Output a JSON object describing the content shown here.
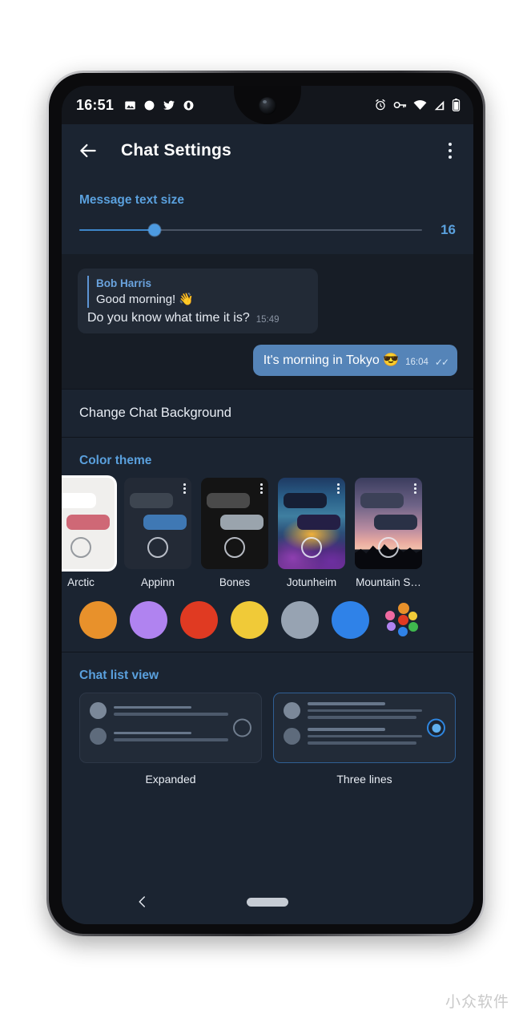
{
  "statusbar": {
    "time": "16:51",
    "left_icons": [
      "gallery-icon",
      "circle-icon",
      "twitter-icon",
      "opera-icon"
    ],
    "right_icons": [
      "alarm-icon",
      "vpn-key-icon",
      "wifi-icon",
      "signal-icon",
      "battery-icon"
    ]
  },
  "appbar": {
    "back_label": "Back",
    "title": "Chat Settings",
    "overflow_label": "More options"
  },
  "text_size": {
    "header": "Message text size",
    "value": "16",
    "percent": 22
  },
  "chat_preview": {
    "incoming": {
      "reply_name": "Bob Harris",
      "reply_text": "Good morning! 👋",
      "text": "Do you know what time it is?",
      "time": "15:49"
    },
    "outgoing": {
      "text": "It's morning in Tokyo 😎",
      "time": "16:04",
      "ticks": "✓✓"
    }
  },
  "background_row": {
    "label": "Change Chat Background"
  },
  "color_theme": {
    "header": "Color theme",
    "themes": [
      {
        "name": "Arctic",
        "art": "art-arctic",
        "selected": true,
        "has_dots": false,
        "mountain": false
      },
      {
        "name": "Appinn",
        "art": "art-appinn",
        "selected": false,
        "has_dots": true,
        "mountain": false
      },
      {
        "name": "Bones",
        "art": "art-bones",
        "selected": false,
        "has_dots": true,
        "mountain": false
      },
      {
        "name": "Jotunheim",
        "art": "art-jotunheim",
        "selected": false,
        "has_dots": true,
        "mountain": false
      },
      {
        "name": "Mountain S…",
        "art": "art-mountain",
        "selected": false,
        "has_dots": true,
        "mountain": true
      }
    ],
    "swatches": [
      {
        "name": "orange",
        "color": "#e8912b"
      },
      {
        "name": "purple",
        "color": "#b083f0"
      },
      {
        "name": "red",
        "color": "#e03a22"
      },
      {
        "name": "yellow",
        "color": "#f0ca38"
      },
      {
        "name": "gray",
        "color": "#97a3b2"
      },
      {
        "name": "blue",
        "color": "#2f82e8"
      }
    ],
    "multicolor_label": "custom-color"
  },
  "chat_list_view": {
    "header": "Chat list view",
    "options": [
      {
        "name": "Expanded",
        "label": "Expanded",
        "selected": false
      },
      {
        "name": "Compact",
        "label": "Three lines",
        "selected": true
      }
    ]
  },
  "navbar": {
    "back_label": "Back",
    "home_label": "Home"
  },
  "watermark": {
    "text": "小众软件"
  }
}
